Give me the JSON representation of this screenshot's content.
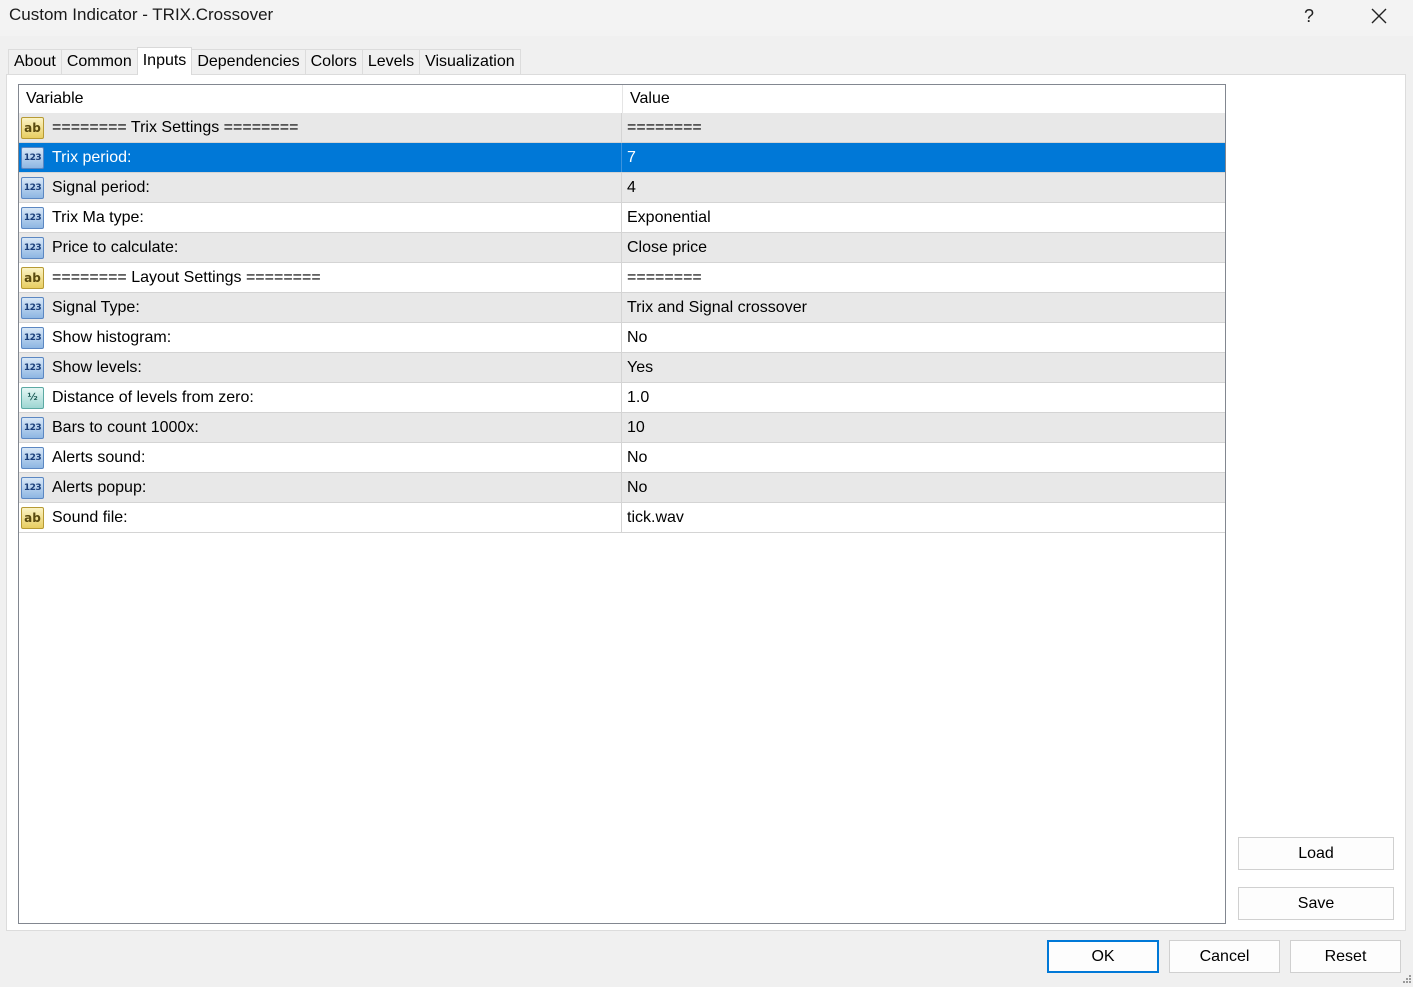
{
  "window": {
    "title": "Custom Indicator - TRIX.Crossover",
    "help_label": "?"
  },
  "tabs": [
    {
      "label": "About"
    },
    {
      "label": "Common"
    },
    {
      "label": "Inputs",
      "active": true
    },
    {
      "label": "Dependencies"
    },
    {
      "label": "Colors"
    },
    {
      "label": "Levels"
    },
    {
      "label": "Visualization"
    }
  ],
  "grid": {
    "columns": {
      "variable": "Variable",
      "value": "Value"
    },
    "selected_row": 1,
    "rows": [
      {
        "icon": "string-icon",
        "icon_text": "ab",
        "variable": "======== Trix Settings ========",
        "value": "========"
      },
      {
        "icon": "integer-icon",
        "icon_text": "123",
        "variable": "Trix period:",
        "value": "7"
      },
      {
        "icon": "integer-icon",
        "icon_text": "123",
        "variable": "Signal period:",
        "value": "4"
      },
      {
        "icon": "integer-icon",
        "icon_text": "123",
        "variable": "Trix Ma type:",
        "value": "Exponential"
      },
      {
        "icon": "integer-icon",
        "icon_text": "123",
        "variable": "Price to calculate:",
        "value": "Close price"
      },
      {
        "icon": "string-icon",
        "icon_text": "ab",
        "variable": "======== Layout Settings ========",
        "value": "========"
      },
      {
        "icon": "integer-icon",
        "icon_text": "123",
        "variable": "Signal Type:",
        "value": "Trix and Signal crossover"
      },
      {
        "icon": "integer-icon",
        "icon_text": "123",
        "variable": "Show histogram:",
        "value": "No"
      },
      {
        "icon": "integer-icon",
        "icon_text": "123",
        "variable": "Show levels:",
        "value": "Yes"
      },
      {
        "icon": "double-icon",
        "icon_text": "½",
        "variable": "Distance of levels from zero:",
        "value": "1.0"
      },
      {
        "icon": "integer-icon",
        "icon_text": "123",
        "variable": "Bars to count 1000x:",
        "value": "10"
      },
      {
        "icon": "integer-icon",
        "icon_text": "123",
        "variable": "Alerts sound:",
        "value": "No"
      },
      {
        "icon": "integer-icon",
        "icon_text": "123",
        "variable": "Alerts popup:",
        "value": "No"
      },
      {
        "icon": "string-icon",
        "icon_text": "ab",
        "variable": "Sound file:",
        "value": "tick.wav"
      }
    ]
  },
  "side_buttons": {
    "load": "Load",
    "save": "Save"
  },
  "footer_buttons": {
    "ok": "OK",
    "cancel": "Cancel",
    "reset": "Reset"
  },
  "colors": {
    "selection": "#0078d7",
    "alt_row": "#e8e8e8"
  }
}
